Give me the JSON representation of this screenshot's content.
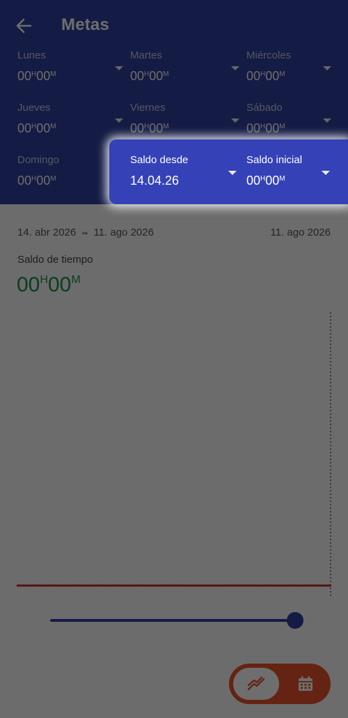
{
  "header": {
    "title": "Metas"
  },
  "days": [
    {
      "label": "Lunes",
      "h": "00",
      "m": "00"
    },
    {
      "label": "Martes",
      "h": "00",
      "m": "00"
    },
    {
      "label": "Miércoles",
      "h": "00",
      "m": "00"
    },
    {
      "label": "Jueves",
      "h": "00",
      "m": "00"
    },
    {
      "label": "Viernes",
      "h": "00",
      "m": "00"
    },
    {
      "label": "Sábado",
      "h": "00",
      "m": "00"
    },
    {
      "label": "Domingo",
      "h": "00",
      "m": "00"
    }
  ],
  "saldo_desde": {
    "label": "Saldo desde",
    "value": "14.04.26"
  },
  "saldo_inicial": {
    "label": "Saldo inicial",
    "h": "00",
    "m": "00"
  },
  "units": {
    "hours": "H",
    "minutes": "M"
  },
  "range": {
    "start": "14. abr 2026",
    "arrow": "⇛",
    "end": "11. ago 2026",
    "current": "11. ago 2026"
  },
  "balance": {
    "label": "Saldo de tiempo",
    "h": "00",
    "m": "00"
  },
  "slider": {
    "value_fraction": 1.0
  },
  "toggle": {
    "selected": "chart",
    "options": [
      "chart-icon",
      "calendar-icon"
    ]
  },
  "colors": {
    "primary": "#2f3f9e",
    "accent": "#e8512d",
    "positive": "#1b8f45",
    "goal_line": "#d9251d"
  }
}
